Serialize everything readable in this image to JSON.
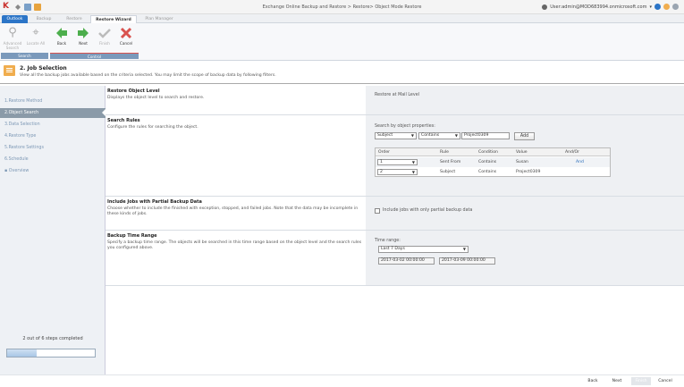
{
  "window": {
    "title": "Exchange Online Backup and Restore > Restore> Object Mode Restore",
    "user": "User:admin@MOD683994.onmicrosoft.com"
  },
  "tabs": [
    {
      "label": "Outlook"
    },
    {
      "label": "Backup"
    },
    {
      "label": "Restore"
    },
    {
      "label": "Restore Wizard"
    },
    {
      "label": "Plan Manager"
    }
  ],
  "ribbon": {
    "search_group": "Search",
    "control_group": "Control",
    "advanced_search": "Advanced Search",
    "locate_all": "Locate All",
    "back": "Back",
    "next": "Next",
    "finish": "Finish",
    "cancel": "Cancel"
  },
  "header": {
    "title": "2. Job Selection",
    "description": "View all the backup jobs available based on the criteria selected. You may limit the scope of backup data by following filters."
  },
  "steps": [
    {
      "label": "1.Restore Method"
    },
    {
      "label": "2.Object Search"
    },
    {
      "label": "3.Data Selection"
    },
    {
      "label": "4.Restore Type"
    },
    {
      "label": "5.Restore Settings"
    },
    {
      "label": "6.Schedule"
    },
    {
      "label": "▪ Overview"
    }
  ],
  "progress": {
    "text": "2 out of 6 steps completed",
    "fraction": 0.333
  },
  "sections": {
    "restore_level": {
      "title": "Restore Object Level",
      "desc": "Displays the object level to search and restore.",
      "value": "Restore at Mail Level"
    },
    "search_rules": {
      "title": "Search Rules",
      "desc": "Configure the rules for searching the object.",
      "by_props": "Search by object properties:",
      "field": "Subject",
      "condition": "Contains",
      "value": "Project0309",
      "add": "Add",
      "columns": [
        "Order",
        "Rule",
        "Condition",
        "Value",
        "And/Or"
      ],
      "rows": [
        {
          "order": "1",
          "rule": "Sent From",
          "condition": "Contains",
          "value": "Susan",
          "andor": "And"
        },
        {
          "order": "2",
          "rule": "Subject",
          "condition": "Contains",
          "value": "Project0309",
          "andor": ""
        }
      ]
    },
    "partial_jobs": {
      "title": "Include Jobs with Partial Backup Data",
      "desc": "Choose whether to include the finished with exception, stopped, and failed jobs. Note that the data may be incomplete in these kinds of jobs.",
      "checkbox": "Include jobs with only partial backup data"
    },
    "time_range": {
      "title": "Backup Time Range",
      "desc": "Specify a backup time range. The objects will be searched in this time range based on the object level and the search rules you configured above.",
      "label": "Time range:",
      "preset": "Last 7 Days",
      "from": "2017-03-02 00:00:00",
      "to": "2017-03-09 00:00:00"
    }
  },
  "footer": {
    "back": "Back",
    "next": "Next",
    "finish": "Finish",
    "cancel": "Cancel"
  },
  "colors": {
    "accent": "#2c75c7",
    "active_step": "#8a9aa8",
    "link": "#2a6ebb",
    "cancel": "#d9534f",
    "nav": "#4cae4c"
  }
}
